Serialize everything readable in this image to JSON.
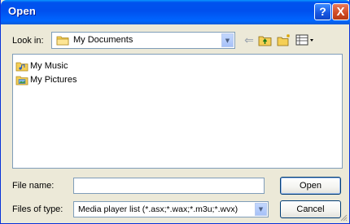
{
  "window": {
    "title": "Open",
    "help_glyph": "?",
    "close_glyph": "X"
  },
  "look_in": {
    "label": "Look in:",
    "value": "My Documents",
    "icon": "folder-icon"
  },
  "toolbar": {
    "back_icon": "back-arrow-icon",
    "up_icon": "up-one-level-icon",
    "new_folder_icon": "new-folder-icon",
    "views_icon": "views-menu-icon"
  },
  "files": [
    {
      "name": "My Music",
      "icon": "music-folder-icon"
    },
    {
      "name": "My Pictures",
      "icon": "pictures-folder-icon"
    }
  ],
  "file_name": {
    "label": "File name:",
    "value": ""
  },
  "file_type": {
    "label": "Files of type:",
    "value": "Media player list (*.asx;*.wax;*.m3u;*.wvx)"
  },
  "buttons": {
    "open": "Open",
    "cancel": "Cancel"
  },
  "colors": {
    "titlebar": "#0053ee",
    "dialog_bg": "#ece9d8",
    "close": "#d04a23",
    "folder": "#f5cf55"
  }
}
